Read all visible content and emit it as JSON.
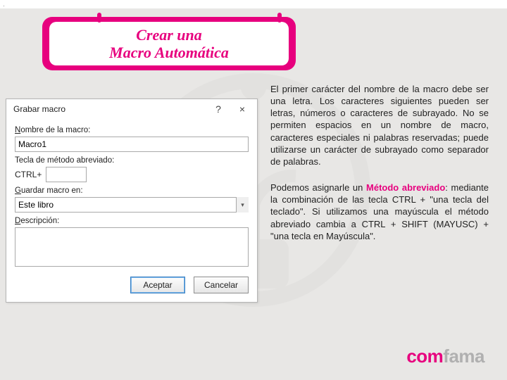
{
  "slide": {
    "title": "Crear una\nMacro Automática",
    "para1": "El primer carácter del nombre de la macro debe ser una letra. Los caracteres siguientes pueden ser letras, números o caracteres de subrayado. No se permiten espacios en un nombre de macro, caracteres especiales ni palabras reservadas; puede utilizarse un carácter de subrayado como separador de palabras.",
    "para2_lead": "Podemos asignarle un ",
    "para2_highlight": "Método abreviado",
    "para2_rest": ": mediante la combinación de las tecla CTRL + \"una tecla del teclado\". Si utilizamos una mayúscula el método abreviado cambia a CTRL + SHIFT (MAYUSC) + \"una tecla en Mayúscula\"."
  },
  "dialog": {
    "title": "Grabar macro",
    "help_icon": "?",
    "close_icon": "×",
    "name_label_pre": "N",
    "name_label_rest": "ombre de la macro:",
    "name_value": "Macro1",
    "shortcut_label": "Tecla de método abreviado:",
    "shortcut_prefix": "CTRL+",
    "shortcut_value": "",
    "store_label_pre": "G",
    "store_label_rest": "uardar macro en:",
    "store_value": "Este libro",
    "desc_label_pre": "D",
    "desc_label_rest": "escripción:",
    "ok_label": "Aceptar",
    "cancel_label": "Cancelar"
  },
  "brand": {
    "part1": "com",
    "part2": "fama"
  }
}
